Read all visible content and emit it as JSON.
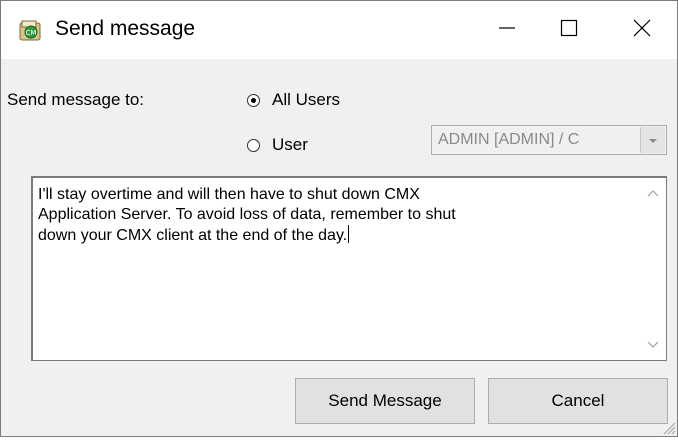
{
  "window": {
    "title": "Send message",
    "controls": [
      "minimize",
      "maximize",
      "close"
    ]
  },
  "form": {
    "send_to_label": "Send message to:",
    "radio_all_users": {
      "label": "All Users",
      "checked": true
    },
    "radio_user": {
      "label": "User",
      "checked": false
    },
    "user_select": {
      "value": "ADMIN [ADMIN] / C",
      "disabled": true
    }
  },
  "message": {
    "text": "I'll stay overtime and will then have to shut down CMX\nApplication Server. To avoid loss of data, remember to shut\ndown your CMX client at the end of the day."
  },
  "buttons": {
    "send_label": "Send Message",
    "cancel_label": "Cancel"
  },
  "icons": {
    "app": "app-icon",
    "minimize": "minimize-icon",
    "maximize": "maximize-icon",
    "close": "close-icon",
    "dropdown": "chevron-down-icon",
    "scroll_up": "chevron-up-icon",
    "scroll_down": "chevron-down-icon"
  },
  "colors": {
    "window_bg": "#f0f0f0",
    "titlebar_bg": "#ffffff",
    "disabled_text": "#8a8a8a"
  }
}
